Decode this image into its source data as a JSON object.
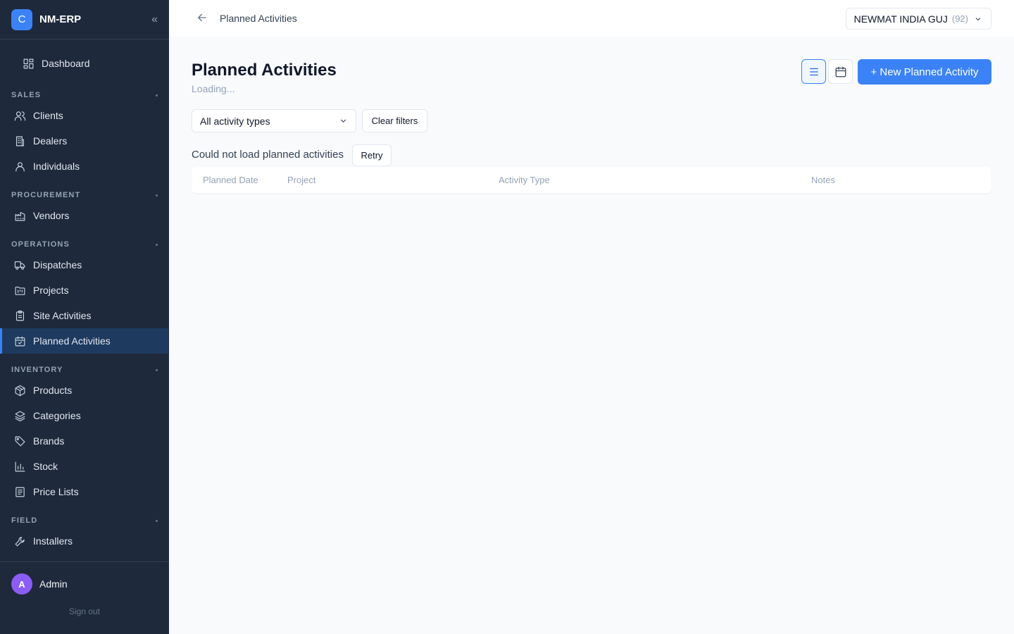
{
  "brand": {
    "logo_letter": "C",
    "name": "NM-ERP",
    "collapse_glyph": "«"
  },
  "sidebar": {
    "dashboard": "Dashboard",
    "sections": {
      "sales": "SALES",
      "procurement": "PROCUREMENT",
      "operations": "OPERATIONS",
      "inventory": "INVENTORY",
      "field": "FIELD"
    },
    "items": {
      "clients": "Clients",
      "dealers": "Dealers",
      "individuals": "Individuals",
      "vendors": "Vendors",
      "dispatches": "Dispatches",
      "projects": "Projects",
      "site_activities": "Site Activities",
      "planned_activities": "Planned Activities",
      "products": "Products",
      "categories": "Categories",
      "brands": "Brands",
      "stock": "Stock",
      "price_lists": "Price Lists",
      "installers": "Installers"
    },
    "active_item": "planned_activities",
    "user": {
      "initial": "A",
      "name": "Admin",
      "sign_out": "Sign out"
    }
  },
  "topbar": {
    "breadcrumb": "Planned Activities",
    "company": {
      "name": "NEWMAT INDIA GUJ",
      "count": "(92)"
    }
  },
  "main": {
    "title": "Planned Activities",
    "status": "Loading...",
    "new_button": "+ New Planned Activity",
    "filter_select": "All activity types",
    "clear_filters": "Clear filters",
    "error_message": "Could not load planned activities",
    "retry": "Retry",
    "columns": [
      "Planned Date",
      "Project",
      "Activity Type",
      "Notes"
    ]
  },
  "colors": {
    "sidebar_bg": "#1e293b",
    "accent": "#3b82f6",
    "active_nav_bg": "#1e3a5f",
    "avatar": "#8b5cf6"
  },
  "icons": {
    "dashboard": "layout-grid-icon",
    "clients": "users-icon",
    "dealers": "building-icon",
    "individuals": "user-icon",
    "vendors": "factory-icon",
    "dispatches": "truck-icon",
    "projects": "folder-kanban-icon",
    "site_activities": "clipboard-list-icon",
    "planned_activities": "calendar-check-icon",
    "products": "package-icon",
    "categories": "layers-icon",
    "brands": "tag-icon",
    "stock": "bar-chart-icon",
    "price_lists": "receipt-icon",
    "installers": "wrench-icon"
  }
}
